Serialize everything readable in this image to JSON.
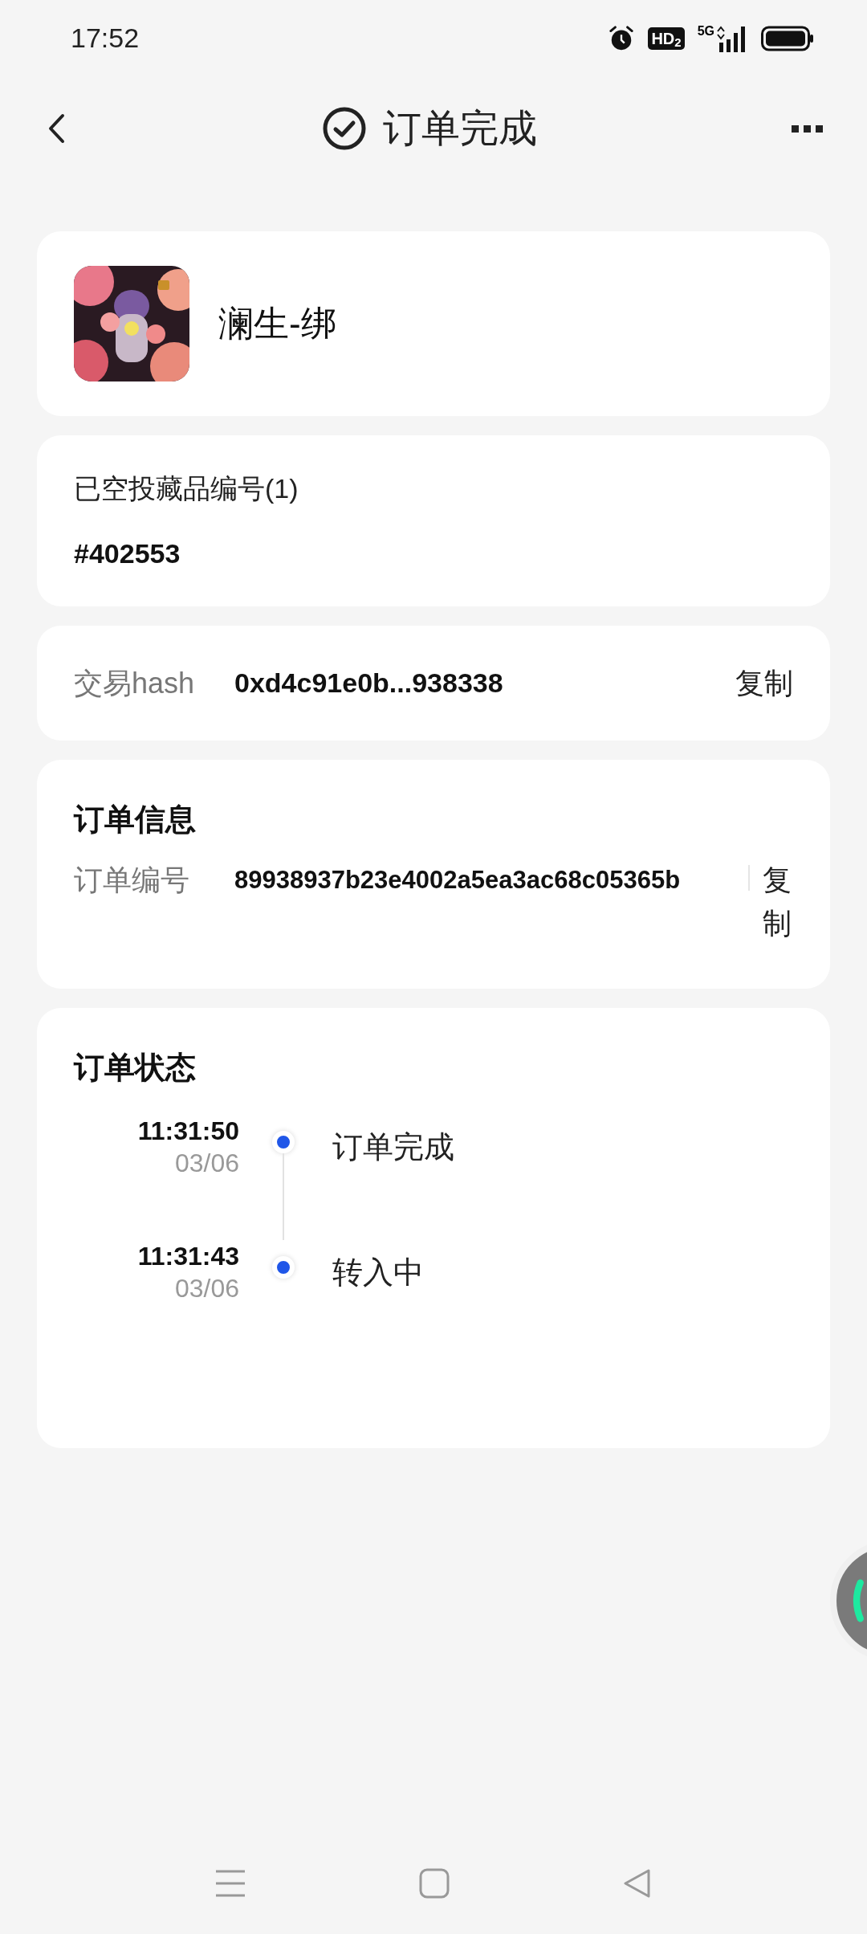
{
  "status_bar": {
    "time": "17:52",
    "network_badge": "HD$_{2}$",
    "network": "5G"
  },
  "header": {
    "title": "订单完成"
  },
  "product": {
    "name": "澜生-绑"
  },
  "airdrop": {
    "label": "已空投藏品编号(1)",
    "value": "#402553"
  },
  "transaction": {
    "label": "交易hash",
    "value": "0xd4c91e0b...938338",
    "action": "复制"
  },
  "order_info": {
    "title": "订单信息",
    "label": "订单编号",
    "value": "89938937b23e4002a5ea3ac68c05365b",
    "action": "复制"
  },
  "order_status": {
    "title": "订单状态",
    "events": [
      {
        "time": "11:31:50",
        "date": "03/06",
        "label": "订单完成"
      },
      {
        "time": "11:31:43",
        "date": "03/06",
        "label": "转入中"
      }
    ]
  }
}
